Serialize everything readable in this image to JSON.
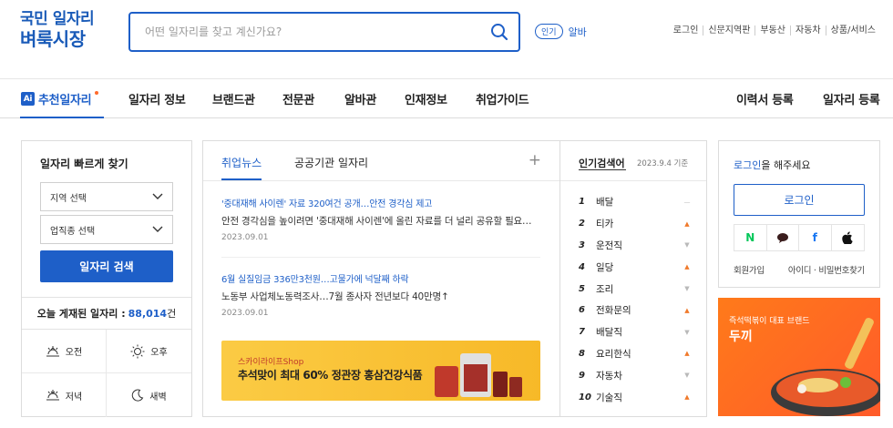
{
  "logo": {
    "line1": "국민 일자리",
    "line2": "벼룩시장"
  },
  "search": {
    "placeholder": "어떤 일자리를 찾고 계신가요?"
  },
  "popular": {
    "badge": "인기",
    "keyword": "알바"
  },
  "toplinks": [
    "로그인",
    "신문지역판",
    "부동산",
    "자동차",
    "상품/서비스"
  ],
  "nav": {
    "ai_label": "추천일자리",
    "ai_badge": "Ai",
    "items": [
      "일자리 정보",
      "브랜드관",
      "전문관",
      "알바관",
      "인재정보",
      "취업가이드"
    ],
    "right_items": [
      "이력서 등록",
      "일자리 등록"
    ]
  },
  "quick": {
    "title": "일자리 빠르게 찾기",
    "region_select": "지역 선택",
    "job_select": "업직종 선택",
    "search_button": "일자리 검색",
    "count_label": "오늘 게재된 일자리 :",
    "count_value": "88,014",
    "count_unit": "건",
    "times": [
      "오전",
      "오후",
      "저녁",
      "새벽"
    ]
  },
  "news": {
    "tabs": [
      "취업뉴스",
      "공공기관 일자리"
    ],
    "plus": "+",
    "articles": [
      {
        "headline": "'중대재해 사이렌' 자료 320여건 공개…안전 경각심 제고",
        "body": "안전 경각심을 높이려면 '중대재해 사이렌'에 올린 자료를 더 널리 공유할 필요…",
        "date": "2023.09.01"
      },
      {
        "headline": "6월 실질임금 336만3천원…고물가에 넉달째 하락",
        "body": "노동부 사업체노동력조사…7월 종사자 전년보다 40만명↑",
        "date": "2023.09.01"
      }
    ],
    "banner": {
      "shop": "스카이라이프Shop",
      "title": "추석맞이 최대 60% 정관장 홍삼건강식품"
    }
  },
  "rank": {
    "title": "인기검색어",
    "date": "2023.9.4 기준",
    "items": [
      {
        "n": "1",
        "t": "배달",
        "trend": "same",
        "sym": "—"
      },
      {
        "n": "2",
        "t": "티카",
        "trend": "up",
        "sym": "▲"
      },
      {
        "n": "3",
        "t": "운전직",
        "trend": "down",
        "sym": "▼"
      },
      {
        "n": "4",
        "t": "일당",
        "trend": "up",
        "sym": "▲"
      },
      {
        "n": "5",
        "t": "조리",
        "trend": "down",
        "sym": "▼"
      },
      {
        "n": "6",
        "t": "전화문의",
        "trend": "up",
        "sym": "▲"
      },
      {
        "n": "7",
        "t": "배달직",
        "trend": "down",
        "sym": "▼"
      },
      {
        "n": "8",
        "t": "요리한식",
        "trend": "up",
        "sym": "▲"
      },
      {
        "n": "9",
        "t": "자동차",
        "trend": "down",
        "sym": "▼"
      },
      {
        "n": "10",
        "t": "기술직",
        "trend": "up",
        "sym": "▲"
      }
    ]
  },
  "login": {
    "link": "로그인",
    "text": "을 해주세요",
    "button": "로그인",
    "social": [
      "N",
      "",
      "f",
      ""
    ],
    "signup": "회원가입",
    "find": "아이디 · 비밀번호찾기"
  },
  "ad": {
    "sub": "즉석떡볶이 대표 브랜드",
    "title": "두끼"
  },
  "colors": {
    "accent": "#1e5fc8",
    "orange": "#f07a2b"
  }
}
